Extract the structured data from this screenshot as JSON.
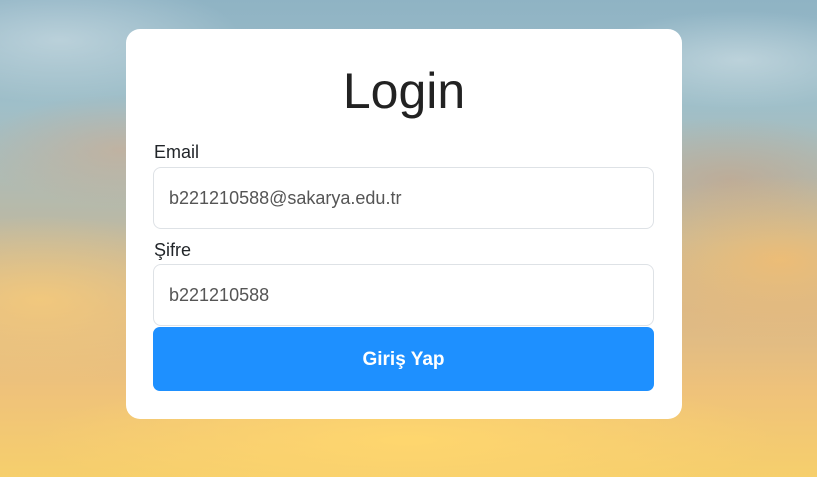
{
  "login": {
    "title": "Login",
    "email_label": "Email",
    "email_value": "b221210588@sakarya.edu.tr",
    "password_label": "Şifre",
    "password_value": "b221210588",
    "submit_label": "Giriş Yap"
  },
  "colors": {
    "button": "#1e90ff",
    "card": "#ffffff"
  }
}
